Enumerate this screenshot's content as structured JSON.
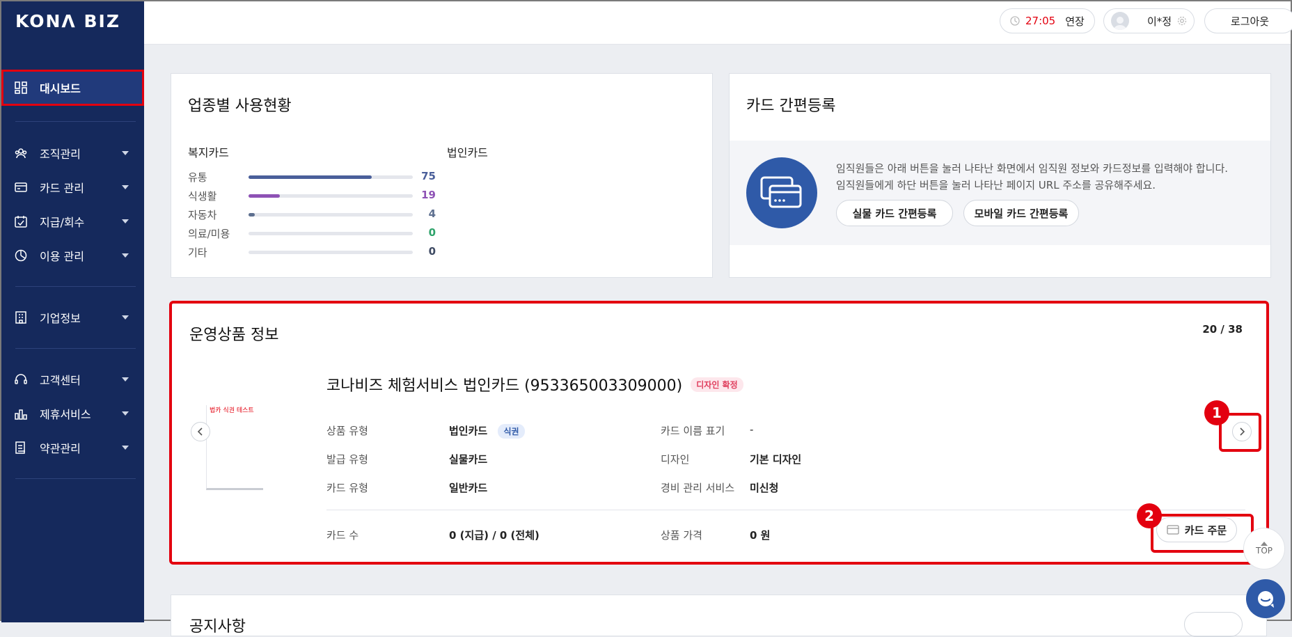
{
  "app": {
    "logo": "KONΛ BIZ"
  },
  "sidebar": {
    "items": [
      {
        "label": "대시보드",
        "icon": "dashboard-icon"
      },
      {
        "label": "조직관리",
        "icon": "organization-icon"
      },
      {
        "label": "카드 관리",
        "icon": "card-icon"
      },
      {
        "label": "지급/회수",
        "icon": "payment-icon"
      },
      {
        "label": "이용 관리",
        "icon": "usage-icon"
      },
      {
        "label": "기업정보",
        "icon": "building-icon"
      },
      {
        "label": "고객센터",
        "icon": "headset-icon"
      },
      {
        "label": "제휴서비스",
        "icon": "partner-icon"
      },
      {
        "label": "약관관리",
        "icon": "document-icon"
      }
    ]
  },
  "topbar": {
    "timer": "27:05",
    "extend_label": "연장",
    "user_name": "이*정",
    "logout_label": "로그아웃"
  },
  "usage": {
    "title": "업종별 사용현황",
    "welfare_label": "복지카드",
    "corporate_label": "법인카드",
    "rows": [
      {
        "label": "유통",
        "value": "75",
        "percent": 75,
        "color": "#4a5f9a"
      },
      {
        "label": "식생활",
        "value": "19",
        "percent": 19,
        "color": "#8e52b5"
      },
      {
        "label": "자동차",
        "value": "4",
        "percent": 4,
        "color": "#5d6f8f"
      },
      {
        "label": "의료/미용",
        "value": "0",
        "percent": 0,
        "color": "#2fa36b"
      },
      {
        "label": "기타",
        "value": "0",
        "percent": 0,
        "color": "#3e4a63"
      }
    ]
  },
  "registration": {
    "title": "카드 간편등록",
    "desc_line1": "임직원들은 아래 버튼을 눌러 나타난 화면에서 임직원 정보와 카드정보를 입력해야 합니다.",
    "desc_line2": "임직원들에게 하단 버튼을 눌러 나타난 페이지 URL 주소를 공유해주세요.",
    "button_physical": "실물 카드 간편등록",
    "button_mobile": "모바일 카드 간편등록"
  },
  "product": {
    "title": "운영상품 정보",
    "page_counter": "20 / 38",
    "card_image_text": "법카 식권 테스트",
    "name": "코나비즈 체험서비스 법인카드 (953365003309000)",
    "status_badge": "디자인 확정",
    "fields": {
      "product_type_label": "상품 유형",
      "product_type_value": "법인카드",
      "product_type_tag": "식권",
      "issue_type_label": "발급 유형",
      "issue_type_value": "실물카드",
      "card_type_label": "카드 유형",
      "card_type_value": "일반카드",
      "card_name_label": "카드 이름 표기",
      "card_name_value": "-",
      "design_label": "디자인",
      "design_value": "기본 디자인",
      "expense_label": "경비 관리 서비스",
      "expense_value": "미신청",
      "card_count_label": "카드 수",
      "card_count_value": "0 (지급) / 0 (전체)",
      "price_label": "상품 가격",
      "price_value": "0 원"
    },
    "order_button": "카드 주문"
  },
  "annotations": {
    "badge1": "1",
    "badge2": "2"
  },
  "bottom_card": {
    "title": "공지사항"
  },
  "floating": {
    "top_label": "TOP"
  },
  "colors": {
    "sidebar_bg": "#15295c",
    "accent_red": "#e3000f",
    "brand_blue": "#2f5aa8"
  }
}
